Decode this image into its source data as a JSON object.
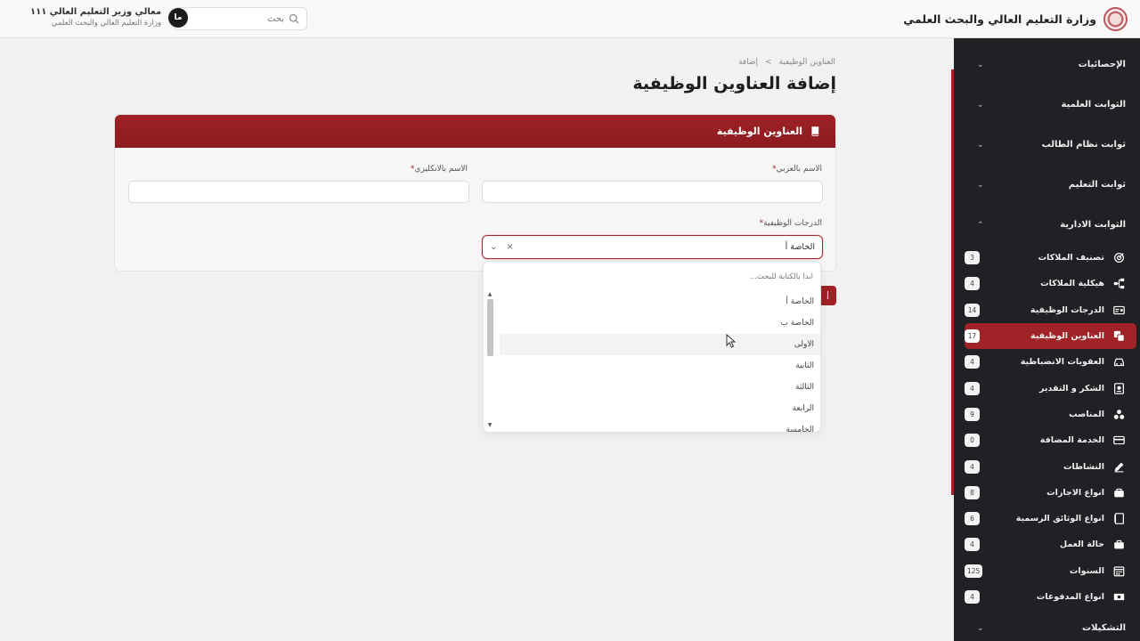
{
  "header": {
    "brand_title": "وزارة التعليم العالي والبحث العلمي",
    "search_placeholder": "بحث",
    "user_name": "معالي وزير التعليم العالي ١١١",
    "user_org": "وزارة التعليم العالي والبحث العلمي",
    "avatar_initials": "ما"
  },
  "sidebar": {
    "sections": [
      {
        "label": "الإحصائيات",
        "chevron": "chevron-down-icon"
      },
      {
        "label": "الثوابت العلمية",
        "chevron": "chevron-down-icon"
      },
      {
        "label": "ثوابت نظام الطالب",
        "chevron": "chevron-down-icon"
      },
      {
        "label": "ثوابت التعليم",
        "chevron": "chevron-down-icon"
      },
      {
        "label": "الثوابت الادارية",
        "chevron": "chevron-up-icon"
      }
    ],
    "items": [
      {
        "label": "تصنيف الملاكات",
        "badge": "3",
        "icon": "target-icon"
      },
      {
        "label": "هيكلية الملاكات",
        "badge": "4",
        "icon": "hierarchy-icon"
      },
      {
        "label": "الدرجات الوظيفية",
        "badge": "14",
        "icon": "id-card-icon"
      },
      {
        "label": "العناوين الوظيفية",
        "badge": "17",
        "icon": "copy-icon",
        "active": true
      },
      {
        "label": "العقوبات الانضباطية",
        "badge": "4",
        "icon": "car-icon"
      },
      {
        "label": "الشكر و التقدير",
        "badge": "4",
        "icon": "certificate-icon"
      },
      {
        "label": "المناصب",
        "badge": "9",
        "icon": "circles-icon"
      },
      {
        "label": "الخدمة المضافة",
        "badge": "0",
        "icon": "card-icon"
      },
      {
        "label": "النشاطات",
        "badge": "4",
        "icon": "pencil-icon"
      },
      {
        "label": "انواع الاجازات",
        "badge": "8",
        "icon": "bag-icon"
      },
      {
        "label": "انواع الوثائق الرسمية",
        "badge": "6",
        "icon": "document-icon"
      },
      {
        "label": "حالة العمل",
        "badge": "4",
        "icon": "briefcase-icon"
      },
      {
        "label": "السنوات",
        "badge": "125",
        "icon": "calendar-icon"
      },
      {
        "label": "انواع المدفوعات",
        "badge": "4",
        "icon": "money-icon"
      }
    ],
    "last_section": {
      "label": "التشكيلات",
      "chevron": "chevron-down-icon"
    }
  },
  "breadcrumb": {
    "parent": "العناوين الوظيفية",
    "separator": ">",
    "current": "إضافة"
  },
  "page_title": "إضافة العناوين الوظيفية",
  "form": {
    "card_title": "العناوين الوظيفية",
    "card_icon": "book-icon",
    "name_ar_label": "الاسم بالعربي",
    "name_en_label": "الاسم بالانكليزي",
    "required_mark": "*",
    "grades_label": "الدرجات الوظيفية",
    "grades_selected": "الخاصة أ",
    "clear_symbol": "×",
    "submit_peek": "إ"
  },
  "dropdown": {
    "search_placeholder": "ابدأ بالكتابة للبحث...",
    "options": [
      "الخاصة أ",
      "الخاصة ب",
      "الاولى",
      "الثانية",
      "الثالثة",
      "الرابعة",
      "الخامسة"
    ],
    "hovered_index": 2
  },
  "colors": {
    "accent": "#9f2125",
    "sidebar_bg": "#202124",
    "page_bg": "#f1f1f1"
  }
}
